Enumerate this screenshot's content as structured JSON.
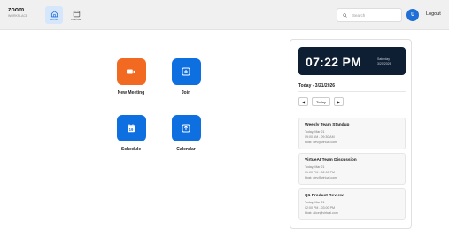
{
  "app": {
    "name": "zoom",
    "subtitle": "WORKPLACE"
  },
  "nav": {
    "tabs": [
      {
        "label": "Home",
        "icon": "home-icon",
        "active": true
      },
      {
        "label": "Calendar",
        "icon": "calendar-icon",
        "active": false
      }
    ]
  },
  "search": {
    "placeholder": "Search"
  },
  "user": {
    "avatar_initial": "U"
  },
  "header": {
    "logout_label": "Logout"
  },
  "actions": [
    {
      "label": "New Meeting",
      "icon": "video-camera-icon",
      "color": "#f26a21"
    },
    {
      "label": "Join",
      "icon": "plus-icon",
      "color": "#0e6fe0"
    },
    {
      "label": "Schedule",
      "icon": "calendar-19-icon",
      "color": "#0e6fe0",
      "icon_text": "19"
    },
    {
      "label": "Calendar",
      "icon": "upload-arrow-icon",
      "color": "#0e6fe0"
    }
  ],
  "clock": {
    "time": "07:22 PM",
    "day": "Saturday",
    "date": "3/21/2026"
  },
  "schedule": {
    "heading": "Today - 3/21/2026",
    "prev_label": "◀",
    "today_label": "Today",
    "next_label": "▶",
    "meetings": [
      {
        "title": "Weekly Team Standup",
        "date": "Today, Mar 21",
        "time": "09:00 AM - 09:30 AM",
        "host": "Host: dev@virtual.com"
      },
      {
        "title": "VirtueAI Team Discussion",
        "date": "Today, Mar 21",
        "time": "01:00 PM - 02:00 PM",
        "host": "Host: dev@virtual.com"
      },
      {
        "title": "Q1 Product Review",
        "date": "Today, Mar 21",
        "time": "02:00 PM - 03:00 PM",
        "host": "Host: alice@virtual.com"
      }
    ]
  },
  "colors": {
    "accent": "#1f6fd6",
    "orange": "#f26a21",
    "blue": "#0e6fe0",
    "clock_bg": "#0f1f33"
  }
}
